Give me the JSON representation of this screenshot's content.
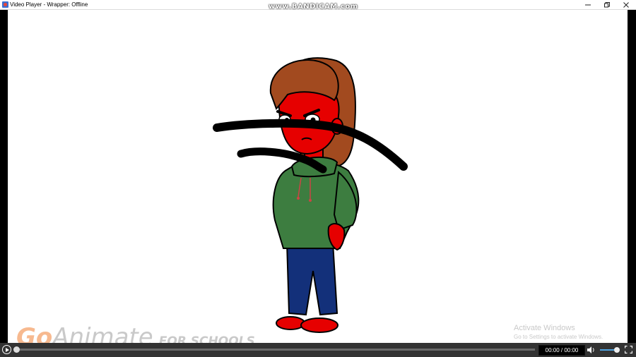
{
  "window": {
    "title": "Video Player - Wrapper: Offline",
    "minimize_icon": "minimize-icon",
    "maximize_icon": "restore-icon",
    "close_icon": "close-icon",
    "titlebar_color": "#ffffff"
  },
  "recording_watermark": "www.BANDICAM.com",
  "stage": {
    "background": "#ffffff",
    "goanimate_watermark": {
      "go": "Go",
      "animate": "Animate",
      "suffix": "FOR SCHOOLS"
    },
    "activation_notice": {
      "title": "Activate Windows",
      "subtitle": "Go to Settings to activate Windows."
    }
  },
  "player": {
    "play_icon": "play-icon",
    "progress": 0,
    "time": "00:00 / 00:00",
    "volume_level": 0.85,
    "volume_icon": "speaker-icon",
    "fullscreen_icon": "fullscreen-icon",
    "bar_color": "#333333",
    "volume_accent": "#4fa3e0"
  }
}
